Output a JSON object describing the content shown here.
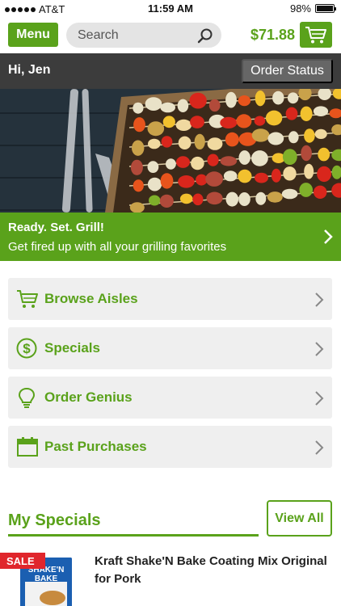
{
  "status_bar": {
    "carrier": "AT&T",
    "time": "11:59 AM",
    "battery": "98%",
    "battery_level": 0.98
  },
  "header": {
    "menu_label": "Menu",
    "search_placeholder": "Search",
    "cart_total": "$71.88"
  },
  "greeting_bar": {
    "greeting": "Hi, Jen",
    "order_status_label": "Order Status"
  },
  "promo": {
    "title": "Ready. Set. Grill!",
    "subtitle": "Get fired up with all your grilling favorites"
  },
  "nav": {
    "items": [
      {
        "label": "Browse Aisles",
        "icon": "cart-icon"
      },
      {
        "label": "Specials",
        "icon": "dollar-circle-icon"
      },
      {
        "label": "Order Genius",
        "icon": "lightbulb-icon"
      },
      {
        "label": "Past Purchases",
        "icon": "calendar-icon"
      }
    ]
  },
  "specials": {
    "title": "My Specials",
    "view_all_label": "View All",
    "items": [
      {
        "badge": "SALE",
        "name": "Kraft Shake'N Bake Coating Mix Original for Pork",
        "image_text": "SHAKE'N BAKE"
      }
    ]
  },
  "colors": {
    "brand_green": "#5aa21b",
    "dark_bar": "#3c3c3c",
    "sale_red": "#e0262c"
  }
}
